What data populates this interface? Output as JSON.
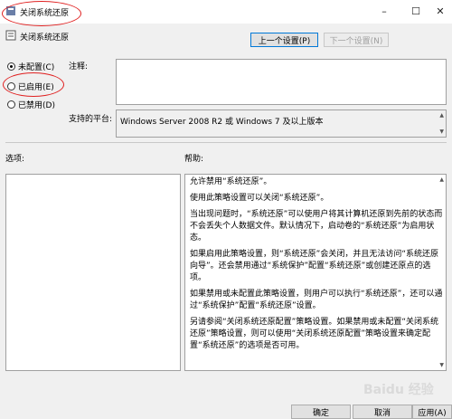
{
  "window": {
    "title": "关闭系统还原",
    "min_icon": "–",
    "max_icon": "☐",
    "close_icon": "✕"
  },
  "header": {
    "policy_name": "关闭系统还原",
    "prev_label": "上一个设置(P)",
    "next_label": "下一个设置(N)"
  },
  "state": {
    "options": [
      {
        "label": "未配置(C)",
        "selected": true
      },
      {
        "label": "已启用(E)",
        "selected": false
      },
      {
        "label": "已禁用(D)",
        "selected": false
      }
    ]
  },
  "comment": {
    "label": "注释:",
    "value": ""
  },
  "supported": {
    "label": "支持的平台:",
    "value": "Windows Server 2008 R2 或 Windows 7 及以上版本"
  },
  "sections": {
    "options_label": "选项:",
    "help_label": "帮助:"
  },
  "help": {
    "paragraphs": [
      "允许禁用“系统还原”。",
      "使用此策略设置可以关闭“系统还原”。",
      "当出现问题时，“系统还原”可以使用户将其计算机还原到先前的状态而不会丢失个人数据文件。默认情况下，启动卷的“系统还原”为启用状态。",
      "如果启用此策略设置，则“系统还原”会关闭，并且无法访问“系统还原向导”。还会禁用通过“系统保护”配置“系统还原”或创建还原点的选项。",
      "如果禁用或未配置此策略设置，则用户可以执行“系统还原”，还可以通过“系统保护”配置“系统还原”设置。",
      "另请参阅“关闭系统还原配置”策略设置。如果禁用或未配置“关闭系统还原”策略设置，则可以使用“关闭系统还原配置”策略设置来确定配置“系统还原”的选项是否可用。"
    ]
  },
  "footer": {
    "ok_label": "确定",
    "cancel_label": "取消",
    "apply_label": "应用(A)"
  },
  "watermark": "Baidu 经验",
  "colors": {
    "annotation": "#e02020",
    "focus": "#0078d7"
  }
}
